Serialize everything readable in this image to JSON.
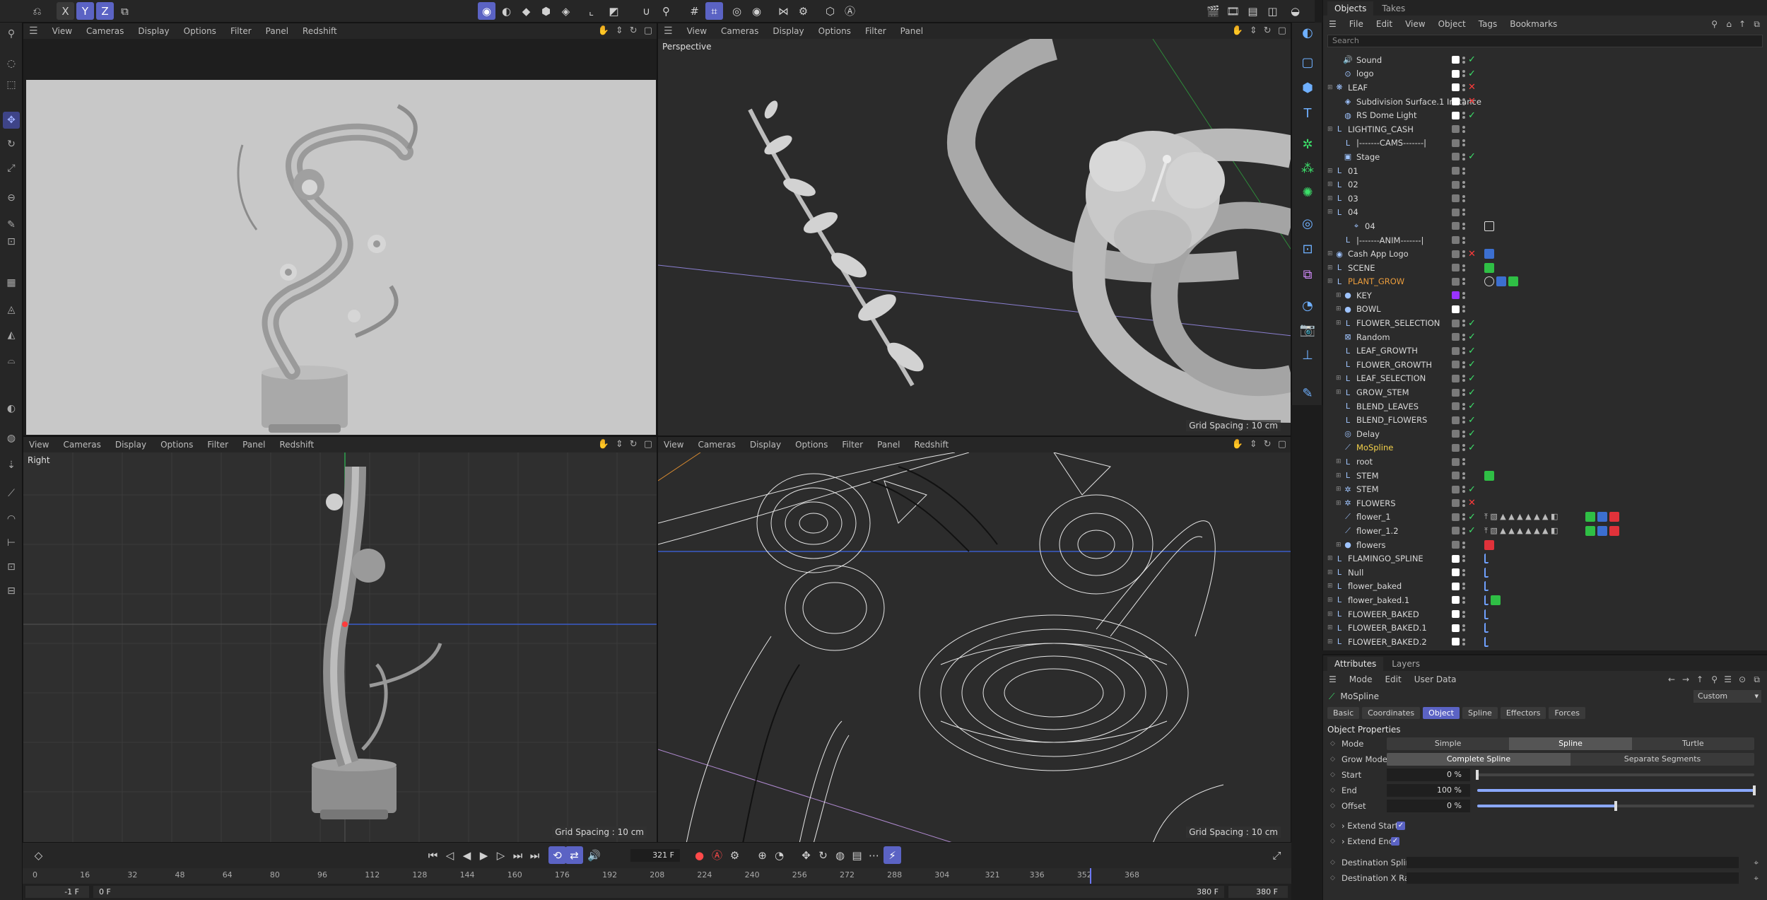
{
  "viewports": {
    "top_left": {
      "menu": [
        "View",
        "Cameras",
        "Display",
        "Options",
        "Filter",
        "Panel",
        "Redshift"
      ]
    },
    "top_right": {
      "menu": [
        "View",
        "Cameras",
        "Display",
        "Options",
        "Filter",
        "Panel"
      ],
      "title": "Perspective",
      "grid": "Grid Spacing : 10 cm"
    },
    "bottom_left": {
      "menu": [
        "View",
        "Cameras",
        "Display",
        "Options",
        "Filter",
        "Panel",
        "Redshift"
      ],
      "title": "Right",
      "grid": "Grid Spacing : 10 cm"
    },
    "bottom_right": {
      "menu": [
        "View",
        "Cameras",
        "Display",
        "Options",
        "Filter",
        "Panel",
        "Redshift"
      ],
      "grid": "Grid Spacing : 10 cm"
    }
  },
  "timeline": {
    "current_frame": "321 F",
    "ticks": [
      "0",
      "16",
      "32",
      "48",
      "64",
      "80",
      "96",
      "112",
      "128",
      "144",
      "160",
      "176",
      "192",
      "208",
      "224",
      "240",
      "256",
      "272",
      "288",
      "304",
      "321",
      "336",
      "352",
      "368"
    ],
    "start_field": "-1 F",
    "start_frame": "0 F",
    "end_frame_a": "380 F",
    "end_frame_b": "380 F"
  },
  "objects_panel": {
    "tabs": [
      "Objects",
      "Takes"
    ],
    "menu": [
      "File",
      "Edit",
      "View",
      "Object",
      "Tags",
      "Bookmarks"
    ],
    "search_placeholder": "Search",
    "rows": [
      {
        "name": "Sound",
        "depth": 1,
        "exp": "",
        "icon": "🔊",
        "color": "#ffffff",
        "s": "chk",
        "tags": []
      },
      {
        "name": "logo",
        "depth": 1,
        "exp": "",
        "icon": "⊙",
        "color": "#ffffff",
        "s": "chk",
        "tags": []
      },
      {
        "name": "LEAF",
        "depth": 0,
        "exp": "+",
        "icon": "❋",
        "color": "#ffffff",
        "s": "crs",
        "tags": []
      },
      {
        "name": "Subdivision Surface.1 Instance",
        "depth": 1,
        "exp": "",
        "icon": "◈",
        "color": "#ffffff",
        "s": "crs",
        "tags": []
      },
      {
        "name": "RS Dome Light",
        "depth": 1,
        "exp": "",
        "icon": "◍",
        "color": "#ffffff",
        "s": "chk",
        "tags": []
      },
      {
        "name": "LIGHTING_CASH",
        "depth": 0,
        "exp": "+",
        "icon": "L",
        "color": "#7a7a7a",
        "s": "",
        "tags": []
      },
      {
        "name": "|-------CAMS-------|",
        "depth": 1,
        "exp": "",
        "icon": "L",
        "color": "#7a7a7a",
        "s": "",
        "tags": []
      },
      {
        "name": "Stage",
        "depth": 1,
        "exp": "",
        "icon": "▣",
        "color": "#7a7a7a",
        "s": "chk",
        "tags": []
      },
      {
        "name": "01",
        "depth": 0,
        "exp": "+",
        "icon": "L",
        "color": "#7a7a7a",
        "s": "",
        "tags": []
      },
      {
        "name": "02",
        "depth": 0,
        "exp": "+",
        "icon": "L",
        "color": "#7a7a7a",
        "s": "",
        "tags": []
      },
      {
        "name": "03",
        "depth": 0,
        "exp": "+",
        "icon": "L",
        "color": "#7a7a7a",
        "s": "",
        "tags": []
      },
      {
        "name": "04",
        "depth": 0,
        "exp": "-",
        "icon": "L",
        "color": "#7a7a7a",
        "s": "",
        "tags": []
      },
      {
        "name": "04",
        "depth": 2,
        "exp": "",
        "icon": "⌖",
        "color": "#7a7a7a",
        "s": "",
        "tags": [
          "target"
        ]
      },
      {
        "name": "|-------ANIM-------|",
        "depth": 1,
        "exp": "",
        "icon": "L",
        "color": "#7a7a7a",
        "s": "",
        "tags": []
      },
      {
        "name": "Cash App Logo",
        "depth": 0,
        "exp": "+",
        "icon": "◉",
        "color": "#7a7a7a",
        "s": "crs",
        "tags": [
          "blue"
        ]
      },
      {
        "name": "SCENE",
        "depth": 0,
        "exp": "+",
        "icon": "L",
        "color": "#7a7a7a",
        "s": "",
        "tags": [
          "green"
        ]
      },
      {
        "name": "PLANT_GROW",
        "depth": 0,
        "exp": "-",
        "icon": "L",
        "color": "#7a7a7a",
        "s": "",
        "tags": [
          "ban",
          "blue",
          "green"
        ],
        "orange": true
      },
      {
        "name": "KEY",
        "depth": 1,
        "exp": "+",
        "icon": "●",
        "color": "#9933ff",
        "s": "",
        "tags": []
      },
      {
        "name": "BOWL",
        "depth": 1,
        "exp": "+",
        "icon": "●",
        "color": "#ffffff",
        "s": "",
        "tags": []
      },
      {
        "name": "FLOWER_SELECTION",
        "depth": 1,
        "exp": "+",
        "icon": "L",
        "color": "#7a7a7a",
        "s": "chk",
        "tags": []
      },
      {
        "name": "Random",
        "depth": 1,
        "exp": "",
        "icon": "⊠",
        "color": "#7a7a7a",
        "s": "chk",
        "tags": []
      },
      {
        "name": "LEAF_GROWTH",
        "depth": 1,
        "exp": "",
        "icon": "L",
        "color": "#7a7a7a",
        "s": "chk",
        "tags": []
      },
      {
        "name": "FLOWER_GROWTH",
        "depth": 1,
        "exp": "",
        "icon": "L",
        "color": "#7a7a7a",
        "s": "chk",
        "tags": []
      },
      {
        "name": "LEAF_SELECTION",
        "depth": 1,
        "exp": "+",
        "icon": "L",
        "color": "#7a7a7a",
        "s": "chk",
        "tags": []
      },
      {
        "name": "GROW_STEM",
        "depth": 1,
        "exp": "+",
        "icon": "L",
        "color": "#7a7a7a",
        "s": "chk",
        "tags": []
      },
      {
        "name": "BLEND_LEAVES",
        "depth": 1,
        "exp": "",
        "icon": "L",
        "color": "#7a7a7a",
        "s": "chk",
        "tags": []
      },
      {
        "name": "BLEND_FLOWERS",
        "depth": 1,
        "exp": "",
        "icon": "L",
        "color": "#7a7a7a",
        "s": "chk",
        "tags": []
      },
      {
        "name": "Delay",
        "depth": 1,
        "exp": "",
        "icon": "◎",
        "color": "#7a7a7a",
        "s": "chk",
        "tags": []
      },
      {
        "name": "MoSpline",
        "depth": 1,
        "exp": "",
        "icon": "⟋",
        "color": "#7a7a7a",
        "s": "chk",
        "tags": [],
        "yellow": true
      },
      {
        "name": "root",
        "depth": 1,
        "exp": "+",
        "icon": "L",
        "color": "#7a7a7a",
        "s": "",
        "tags": []
      },
      {
        "name": "STEM",
        "depth": 1,
        "exp": "+",
        "icon": "L",
        "color": "#7a7a7a",
        "s": "",
        "tags": [
          "green"
        ]
      },
      {
        "name": "STEM",
        "depth": 1,
        "exp": "+",
        "icon": "✲",
        "color": "#7a7a7a",
        "s": "chk",
        "tags": []
      },
      {
        "name": "FLOWERS",
        "depth": 1,
        "exp": "+",
        "icon": "✲",
        "color": "#7a7a7a",
        "s": "crs",
        "tags": []
      },
      {
        "name": "flower_1",
        "depth": 1,
        "exp": "",
        "icon": "⟋",
        "color": "#7a7a7a",
        "s": "chk",
        "tags": [
          "many"
        ]
      },
      {
        "name": "flower_1.2",
        "depth": 1,
        "exp": "",
        "icon": "⟋",
        "color": "#7a7a7a",
        "s": "chk",
        "tags": [
          "many"
        ]
      },
      {
        "name": "flowers",
        "depth": 1,
        "exp": "+",
        "icon": "●",
        "color": "#7a7a7a",
        "s": "",
        "tags": [
          "red"
        ]
      },
      {
        "name": "FLAMINGO_SPLINE",
        "depth": 0,
        "exp": "+",
        "icon": "L",
        "color": "#ffffff",
        "s": "",
        "tags": [
          "small"
        ]
      },
      {
        "name": "Null",
        "depth": 0,
        "exp": "+",
        "icon": "L",
        "color": "#ffffff",
        "s": "",
        "tags": [
          "small"
        ]
      },
      {
        "name": "flower_baked",
        "depth": 0,
        "exp": "+",
        "icon": "L",
        "color": "#ffffff",
        "s": "",
        "tags": [
          "small"
        ]
      },
      {
        "name": "flower_baked.1",
        "depth": 0,
        "exp": "+",
        "icon": "L",
        "color": "#ffffff",
        "s": "",
        "tags": [
          "small",
          "green"
        ]
      },
      {
        "name": "FLOWEER_BAKED",
        "depth": 0,
        "exp": "+",
        "icon": "L",
        "color": "#ffffff",
        "s": "",
        "tags": [
          "small"
        ]
      },
      {
        "name": "FLOWEER_BAKED.1",
        "depth": 0,
        "exp": "+",
        "icon": "L",
        "color": "#ffffff",
        "s": "",
        "tags": [
          "small"
        ]
      },
      {
        "name": "FLOWEER_BAKED.2",
        "depth": 0,
        "exp": "+",
        "icon": "L",
        "color": "#ffffff",
        "s": "",
        "tags": [
          "small"
        ]
      }
    ]
  },
  "attributes_panel": {
    "tabs": [
      "Attributes",
      "Layers"
    ],
    "menu": [
      "Mode",
      "Edit",
      "User Data"
    ],
    "object_name": "MoSpline",
    "preset": "Custom",
    "subtabs": [
      "Basic",
      "Coordinates",
      "Object",
      "Spline",
      "Effectors",
      "Forces"
    ],
    "active_subtab": "Object",
    "section": "Object Properties",
    "mode": {
      "label": "Mode",
      "options": [
        "Simple",
        "Spline",
        "Turtle"
      ],
      "selected": "Spline"
    },
    "grow_mode": {
      "label": "Grow Mode",
      "options": [
        "Complete Spline",
        "Separate Segments"
      ],
      "selected": "Complete Spline"
    },
    "start": {
      "label": "Start",
      "value": "0 %",
      "fraction": 0.0
    },
    "end": {
      "label": "End",
      "value": "100 %",
      "fraction": 1.0
    },
    "offset": {
      "label": "Offset",
      "value": "0 %",
      "fraction": 0.5
    },
    "extend_start": "Extend Start",
    "extend_end": "Extend End",
    "destination_spline": "Destination Spline",
    "destination_x_rail": "Destination X Rail"
  },
  "colors": {
    "accent": "#5b63c4",
    "ok": "#3ce06a",
    "off": "#ff3b3b",
    "highlight_orange": "#e89b3c",
    "highlight_yellow": "#f5d24b"
  }
}
